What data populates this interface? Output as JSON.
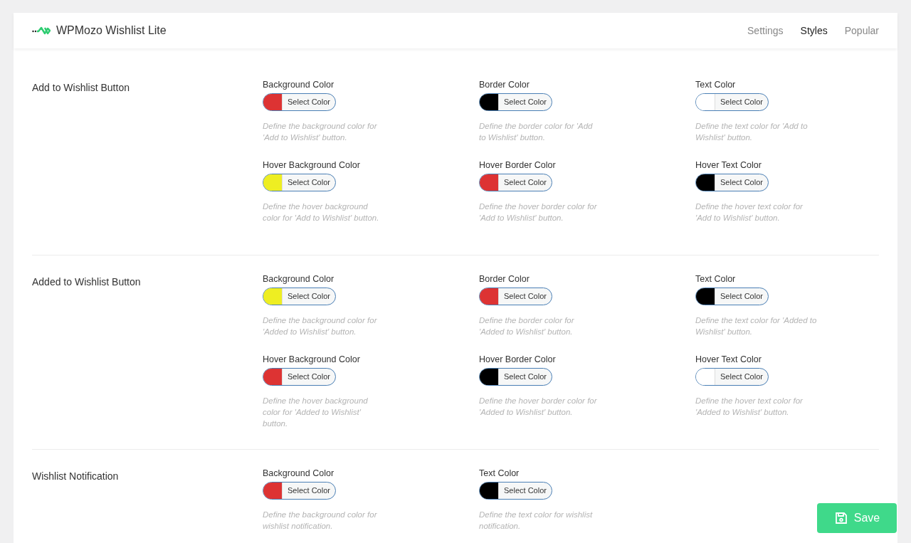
{
  "header": {
    "title": "WPMozo Wishlist Lite",
    "tabs": [
      {
        "label": "Settings",
        "selected": false
      },
      {
        "label": "Styles",
        "selected": true
      },
      {
        "label": "Popular",
        "selected": false
      }
    ]
  },
  "sections": [
    {
      "title": "Add to Wishlist Button",
      "fields": [
        {
          "label": "Background Color",
          "color": "#dd3333",
          "button": "Select Color",
          "description": "Define the background color for 'Add to Wishlist' button."
        },
        {
          "label": "Border Color",
          "color": "#000000",
          "button": "Select Color",
          "description": "Define the border color for 'Add to Wishlist' button."
        },
        {
          "label": "Text Color",
          "color": "#ffffff",
          "button": "Select Color",
          "description": "Define the text color for 'Add to Wishlist' button."
        },
        {
          "label": "Hover Background Color",
          "color": "#eeee22",
          "button": "Select Color",
          "description": "Define the hover background color for 'Add to Wishlist' button."
        },
        {
          "label": "Hover Border Color",
          "color": "#dd3333",
          "button": "Select Color",
          "description": "Define the hover border color for 'Add to Wishlist' button."
        },
        {
          "label": "Hover Text Color",
          "color": "#000000",
          "button": "Select Color",
          "description": "Define the hover text color for 'Add to Wishlist' button."
        }
      ]
    },
    {
      "title": "Added to Wishlist Button",
      "fields": [
        {
          "label": "Background Color",
          "color": "#eeee22",
          "button": "Select Color",
          "description": "Define the background color for 'Added to Wishlist' button."
        },
        {
          "label": "Border Color",
          "color": "#dd3333",
          "button": "Select Color",
          "description": "Define the border color for 'Added to Wishlist' button."
        },
        {
          "label": "Text Color",
          "color": "#000000",
          "button": "Select Color",
          "description": "Define the text color for 'Added to Wishlist' button."
        },
        {
          "label": "Hover Background Color",
          "color": "#dd3333",
          "button": "Select Color",
          "description": "Define the hover background color for 'Added to Wishlist' button."
        },
        {
          "label": "Hover Border Color",
          "color": "#000000",
          "button": "Select Color",
          "description": "Define the hover border color for 'Added to Wishlist' button."
        },
        {
          "label": "Hover Text Color",
          "color": "#ffffff",
          "button": "Select Color",
          "description": "Define the hover text color for 'Added to Wishlist' button."
        }
      ]
    },
    {
      "title": "Wishlist Notification",
      "fields": [
        {
          "label": "Background Color",
          "color": "#dd3333",
          "button": "Select Color",
          "description": "Define the background color for wishlist notification."
        },
        {
          "label": "Text Color",
          "color": "#000000",
          "button": "Select Color",
          "description": "Define the text color for wishlist notification."
        }
      ]
    }
  ],
  "save_button": "Save"
}
